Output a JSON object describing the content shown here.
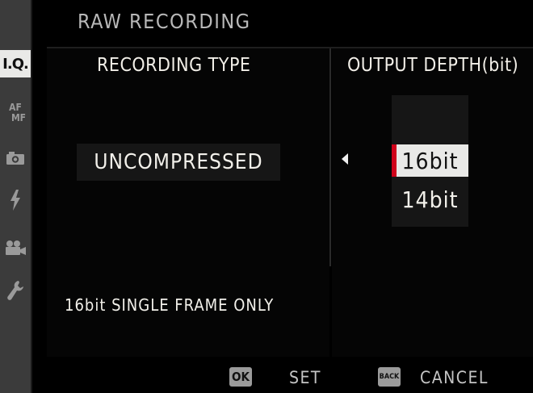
{
  "sidebar": {
    "items": [
      {
        "label": "I.Q.",
        "icon": "image-quality-icon",
        "active": true
      },
      {
        "label_top": "AF",
        "label_bottom": "MF",
        "icon": "af-mf-icon"
      },
      {
        "icon": "camera-icon"
      },
      {
        "icon": "flash-icon"
      },
      {
        "icon": "movie-camera-icon"
      },
      {
        "icon": "wrench-icon"
      }
    ]
  },
  "header": {
    "title": "RAW RECORDING"
  },
  "columns": {
    "recording_type": {
      "heading": "RECORDING TYPE",
      "value": "UNCOMPRESSED"
    },
    "output_depth": {
      "heading": "OUTPUT DEPTH(bit)",
      "options": [
        "16bit",
        "14bit"
      ],
      "selected": "16bit"
    }
  },
  "note": "16bit SINGLE FRAME ONLY",
  "footer": {
    "ok_key": "OK",
    "ok_action": "SET",
    "back_key": "BACK",
    "back_action": "CANCEL"
  },
  "colors": {
    "background": "#000000",
    "sidebar": "#3b3b3b",
    "selection": "#e9e9e7",
    "selection_marker": "#d0021b",
    "text": "#f2f0ea"
  }
}
